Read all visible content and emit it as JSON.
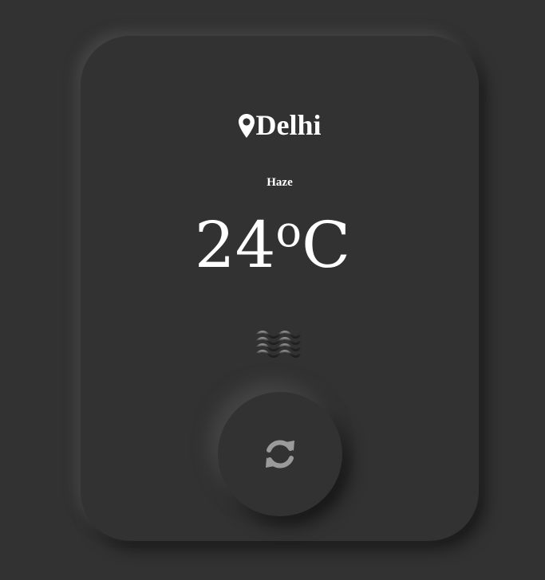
{
  "weather": {
    "city": "Delhi",
    "condition": "Haze",
    "temperature": "24",
    "degree_symbol": "o",
    "unit": "C"
  },
  "icons": {
    "location": "map-pin-icon",
    "condition": "haze-icon",
    "refresh": "refresh-icon"
  },
  "colors": {
    "background": "#323232",
    "text": "#ffffff",
    "refresh_icon": "#9a9a9a"
  }
}
